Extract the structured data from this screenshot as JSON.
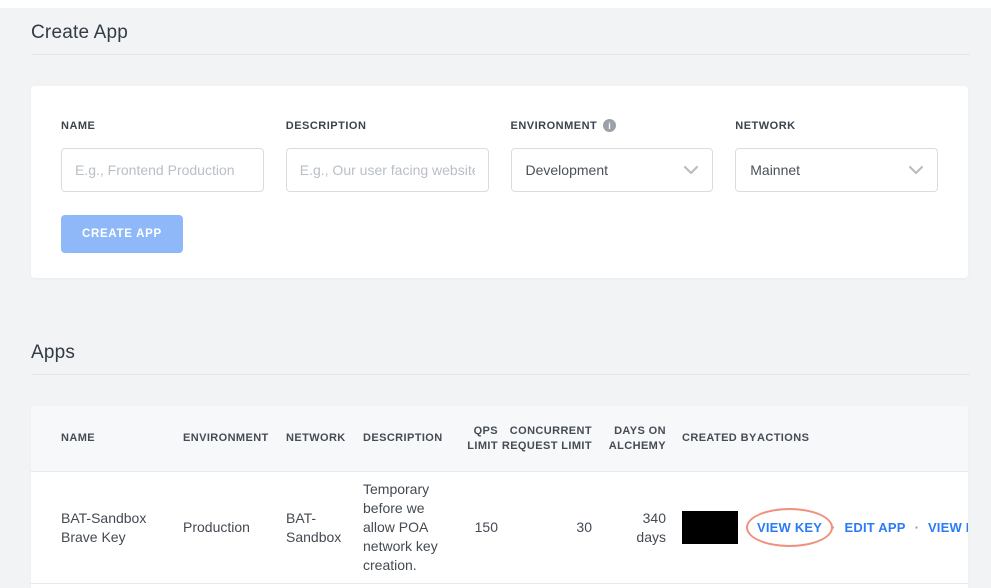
{
  "create_app_section": {
    "title": "Create App",
    "form": {
      "name": {
        "label": "NAME",
        "placeholder": "E.g., Frontend Production",
        "value": ""
      },
      "description": {
        "label": "DESCRIPTION",
        "placeholder": "E.g., Our user facing website",
        "value": ""
      },
      "environment": {
        "label": "ENVIRONMENT",
        "selected_value": "Development",
        "info_icon_glyph": "i"
      },
      "network": {
        "label": "NETWORK",
        "selected_value": "Mainnet"
      },
      "submit_label": "CREATE APP"
    }
  },
  "apps_section": {
    "title": "Apps",
    "table": {
      "columns": [
        "NAME",
        "ENVIRONMENT",
        "NETWORK",
        "DESCRIPTION",
        "QPS LIMIT",
        "CONCURRENT REQUEST LIMIT",
        "DAYS ON ALCHEMY",
        "CREATED BY",
        "ACTIONS"
      ],
      "rows": [
        {
          "name": "BAT-Sandbox Brave Key",
          "environment": "Production",
          "network": "BAT-Sandbox",
          "description": "Temporary before we allow POA network key creation.",
          "qps_limit": "150",
          "concurrent_request_limit": "30",
          "days_on_alchemy": "340 days",
          "created_by_redacted": true,
          "actions": [
            "VIEW KEY",
            "EDIT APP",
            "VIEW DETAILS"
          ],
          "actions_separator": "·"
        }
      ]
    }
  },
  "icons": {
    "environment_info": "info-icon",
    "dropdown": "chevron-down-icon"
  },
  "colors": {
    "page_background": "#f2f3f5",
    "card_background": "#ffffff",
    "accent_link_blue": "#2b7bf7",
    "button_blue": "#8fb8f8",
    "highlight_ellipse": "#f0907d",
    "redaction": "#000000",
    "table_header_background": "#f7f8f9"
  }
}
